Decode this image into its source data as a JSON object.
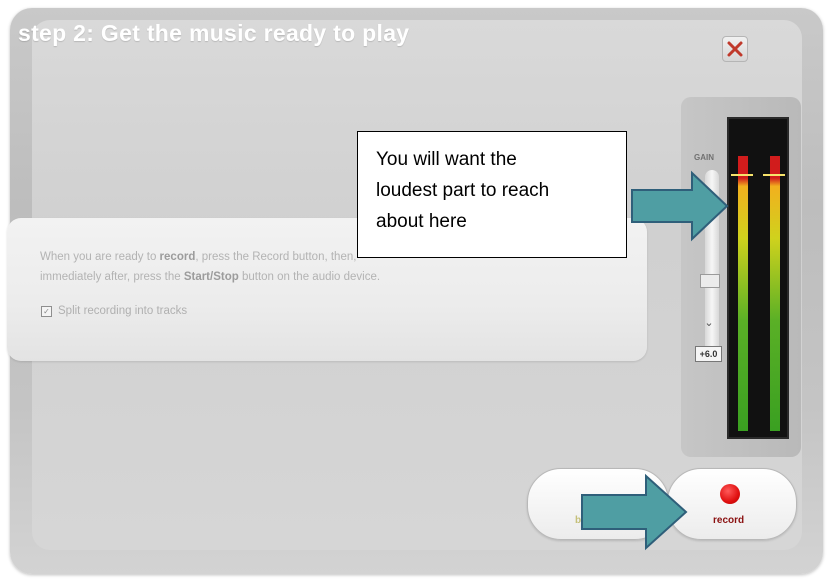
{
  "dialog": {
    "title": "step 2: Get the music ready to play",
    "close_icon": "close-x-icon"
  },
  "instructions": {
    "line1_pre": "When you are ready to ",
    "line1_bold": "record",
    "line1_post": ", press the Record button, then,",
    "line2_pre": "immediately after, press the ",
    "line2_bold": "Start/Stop",
    "line2_post": " button on the audio device."
  },
  "split_tracks": {
    "label": "Split recording into tracks",
    "checked": true
  },
  "level_meter": {
    "gain_label": "GAIN",
    "db_value": "+6.0",
    "colors": {
      "red": "#d11c1c",
      "yellow": "#cfd21d",
      "green": "#3aa021"
    }
  },
  "buttons": {
    "back_label": "back",
    "record_label": "record"
  },
  "callout": {
    "text_line1": "You will want the",
    "text_line2": "loudest part to reach",
    "text_line3": "about here"
  },
  "colors": {
    "arrow_fill": "#4f9ea3",
    "arrow_stroke": "#2f5f7a"
  }
}
